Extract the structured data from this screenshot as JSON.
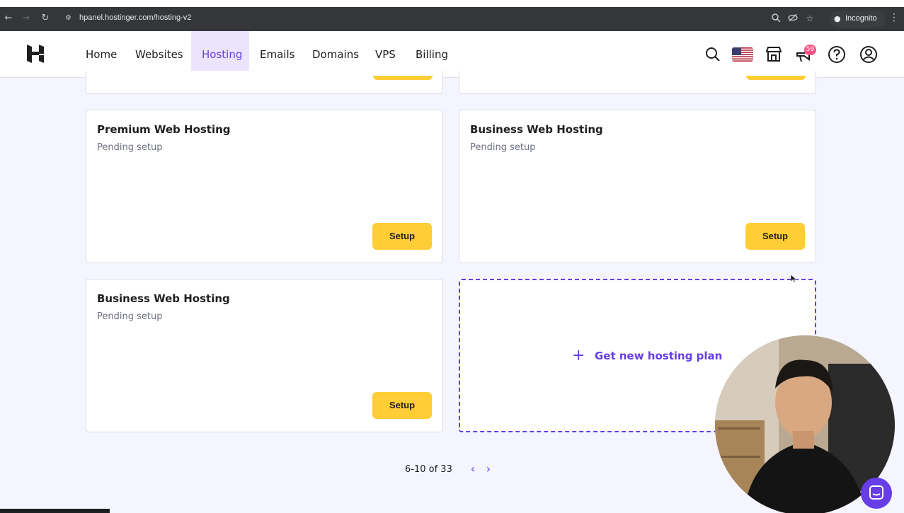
{
  "browser": {
    "url": "hpanel.hostinger.com/hosting-v2",
    "incognito_label": "Incognito",
    "icons": [
      "back-icon",
      "forward-icon",
      "reload-icon",
      "site-info-icon",
      "zoom-icon",
      "eye-off-icon",
      "star-icon",
      "incognito-icon",
      "kebab-menu-icon"
    ]
  },
  "header": {
    "nav": [
      {
        "label": "Home"
      },
      {
        "label": "Websites"
      },
      {
        "label": "Hosting",
        "active": true
      },
      {
        "label": "Emails"
      },
      {
        "label": "Domains"
      },
      {
        "label": "VPS"
      },
      {
        "label": "Billing"
      }
    ],
    "notifications_count": "59",
    "accent_color": "#673de6"
  },
  "cards": [
    {
      "title": "Premium Web Hosting",
      "status": "Pending setup",
      "button": "Setup"
    },
    {
      "title": "Business Web Hosting",
      "status": "Pending setup",
      "button": "Setup"
    },
    {
      "title": "Business Web Hosting",
      "status": "Pending setup",
      "button": "Setup"
    }
  ],
  "new_plan": {
    "label": "Get new hosting plan"
  },
  "pagination": {
    "text": "6-10 of 33"
  },
  "colors": {
    "button_yellow": "#ffcd35",
    "purple": "#673de6",
    "badge_pink": "#fc5185"
  }
}
